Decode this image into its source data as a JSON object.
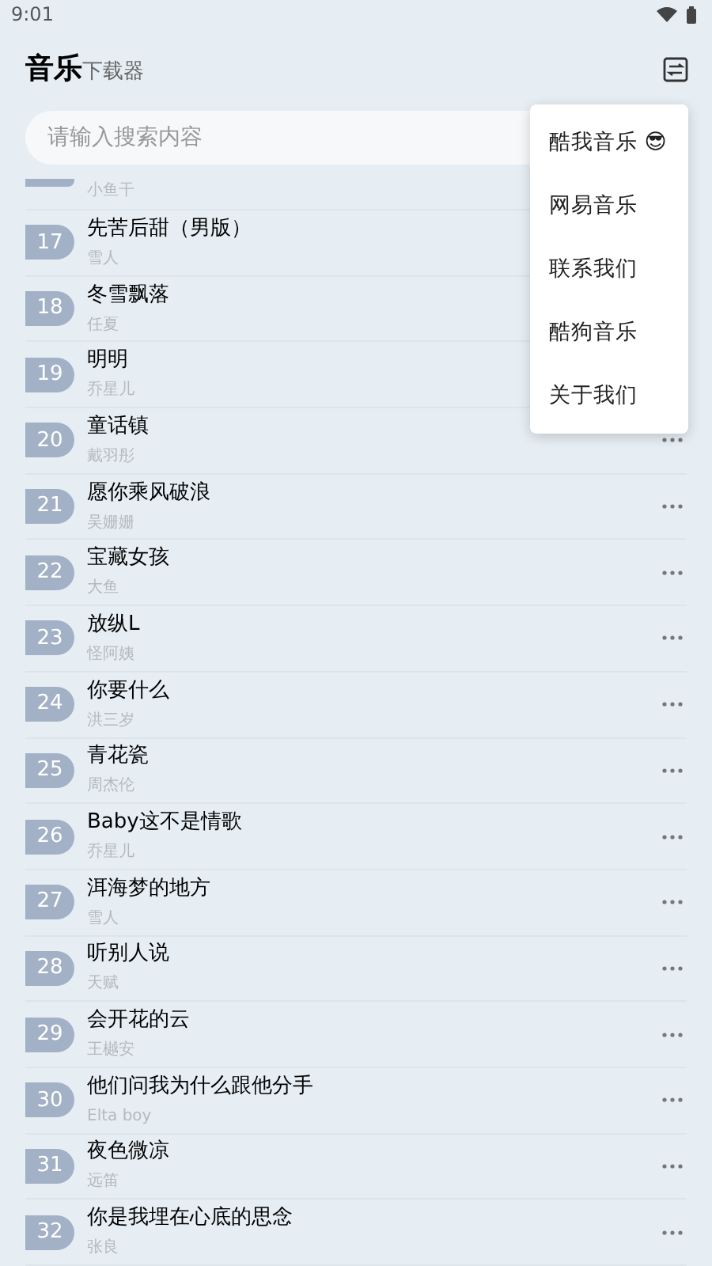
{
  "status_bar": {
    "time": "9:01"
  },
  "header": {
    "title": "音乐",
    "subtitle": "下载器"
  },
  "search": {
    "placeholder": "请输入搜索内容"
  },
  "songs": [
    {
      "kind": "partial",
      "artist": "小鱼干"
    },
    {
      "kind": "full",
      "number": "17",
      "title": "先苦后甜（男版）",
      "artist": "雪人"
    },
    {
      "kind": "full",
      "number": "18",
      "title": "冬雪飘落",
      "artist": "任夏"
    },
    {
      "kind": "full",
      "number": "19",
      "title": "明明",
      "artist": "乔星儿"
    },
    {
      "kind": "full",
      "number": "20",
      "title": "童话镇",
      "artist": "戴羽彤"
    },
    {
      "kind": "full",
      "number": "21",
      "title": "愿你乘风破浪",
      "artist": "吴姗姗"
    },
    {
      "kind": "full",
      "number": "22",
      "title": "宝藏女孩",
      "artist": "大鱼"
    },
    {
      "kind": "full",
      "number": "23",
      "title": "放纵L",
      "artist": "怪阿姨"
    },
    {
      "kind": "full",
      "number": "24",
      "title": "你要什么",
      "artist": "洪三岁"
    },
    {
      "kind": "full",
      "number": "25",
      "title": "青花瓷",
      "artist": "周杰伦"
    },
    {
      "kind": "full",
      "number": "26",
      "title": "Baby这不是情歌",
      "artist": "乔星儿"
    },
    {
      "kind": "full",
      "number": "27",
      "title": "洱海梦的地方",
      "artist": "雪人"
    },
    {
      "kind": "full",
      "number": "28",
      "title": "听别人说",
      "artist": "天赋"
    },
    {
      "kind": "full",
      "number": "29",
      "title": "会开花的云",
      "artist": "王樾安"
    },
    {
      "kind": "full",
      "number": "30",
      "title": "他们问我为什么跟他分手",
      "artist": "Elta boy"
    },
    {
      "kind": "full",
      "number": "31",
      "title": "夜色微凉",
      "artist": "远笛"
    },
    {
      "kind": "full",
      "number": "32",
      "title": "你是我埋在心底的思念",
      "artist": "张良"
    }
  ],
  "menu": {
    "items": [
      "酷我音乐 😎",
      "网易音乐",
      "联系我们",
      "酷狗音乐",
      "关于我们"
    ]
  }
}
